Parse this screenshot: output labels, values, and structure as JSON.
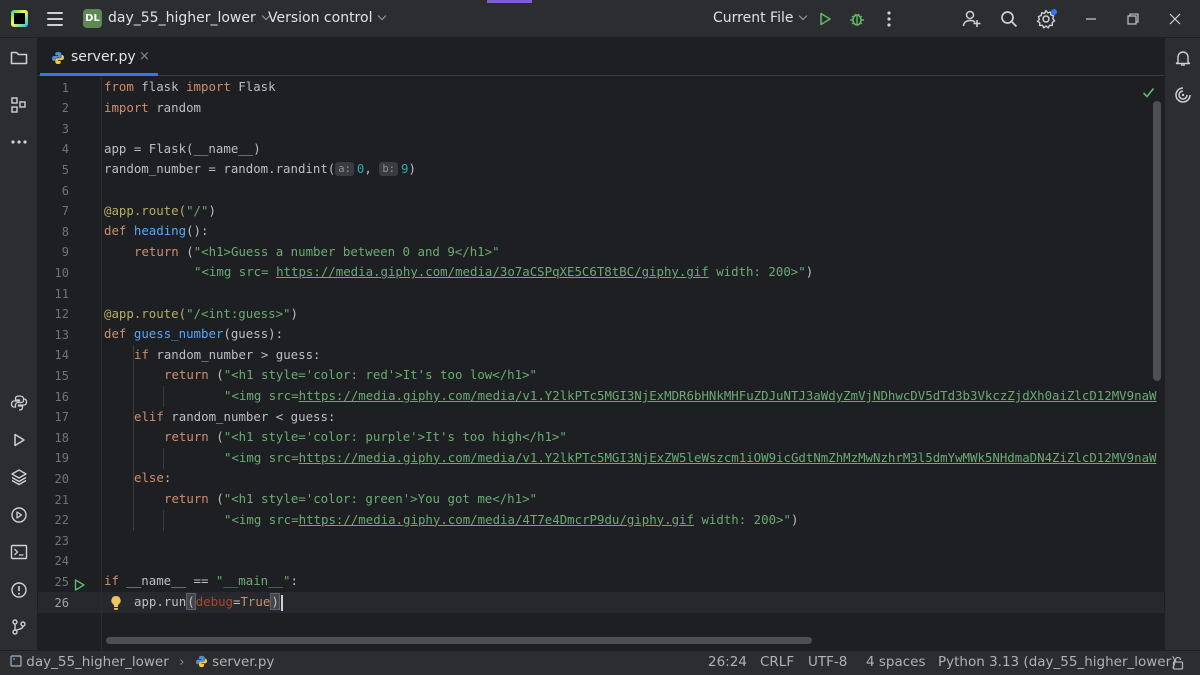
{
  "titlebar": {
    "project_initials": "DL",
    "project_name": "day_55_higher_lower",
    "vcs_label": "Version control",
    "run_config": "Current File"
  },
  "tabs": [
    {
      "label": "server.py",
      "close": "×"
    }
  ],
  "editor": {
    "line_numbers": [
      "1",
      "2",
      "3",
      "4",
      "5",
      "6",
      "7",
      "8",
      "9",
      "10",
      "11",
      "12",
      "13",
      "14",
      "15",
      "16",
      "17",
      "18",
      "19",
      "20",
      "21",
      "22",
      "23",
      "24",
      "25",
      "26"
    ],
    "inlay_hints": {
      "a": "a:",
      "b": "b:"
    },
    "lines": {
      "l1": [
        "from",
        " flask ",
        "import",
        " Flask"
      ],
      "l2": [
        "import",
        " random"
      ],
      "l4": "app = Flask(__name__)",
      "l5": [
        "random_number = random.randint(",
        "0",
        ", ",
        "9",
        ")"
      ],
      "l7": [
        "@app.route(",
        "\"/\"",
        ")"
      ],
      "l8": [
        "def",
        " ",
        "heading",
        "():"
      ],
      "l9": [
        "return",
        " (",
        "\"<h1>Guess a number between 0 and 9</h1>\""
      ],
      "l10": [
        "\"<img src= ",
        "https://media.giphy.com/media/3o7aCSPqXE5C6T8tBC/giphy.gif",
        " width: 200>\"",
        ")"
      ],
      "l12": [
        "@app.route(",
        "\"/<int:guess>\"",
        ")"
      ],
      "l13": [
        "def",
        " ",
        "guess_number",
        "(guess):"
      ],
      "l14": [
        "if",
        " random_number > guess:"
      ],
      "l15": [
        "return",
        " (",
        "\"<h1 style='color: red'>It's too low</h1>\""
      ],
      "l16": [
        "\"<img src=",
        "https://media.giphy.com/media/v1.Y2lkPTc5MGI3NjExMDR6bHNkMHFuZDJuNTJ3aWdyZmVjNDhwcDV5dTd3b3VkczZjdXh0aiZlcD12MV9naW"
      ],
      "l17": [
        "elif",
        " random_number < guess:"
      ],
      "l18": [
        "return",
        " (",
        "\"<h1 style='color: purple'>It's too high</h1>\""
      ],
      "l19": [
        "\"<img src=",
        "https://media.giphy.com/media/v1.Y2lkPTc5MGI3NjExZW5leWszcm1iOW9icGdtNmZhMzMwNzhrM3l5dmYwMWk5NHdmaDN4ZiZlcD12MV9naW"
      ],
      "l20": [
        "else",
        ":"
      ],
      "l21": [
        "return",
        " (",
        "\"<h1 style='color: green'>You got me</h1>\""
      ],
      "l22": [
        "\"<img src=",
        "https://media.giphy.com/media/4T7e4DmcrP9du/giphy.gif",
        " width: 200>\"",
        ")"
      ],
      "l25": [
        "if",
        " __name__ == ",
        "\"__main__\"",
        ":"
      ],
      "l26": [
        "app.run",
        "(",
        "debug",
        "=",
        "True",
        ")"
      ]
    }
  },
  "statusbar": {
    "breadcrumb_project": "day_55_higher_lower",
    "breadcrumb_file": "server.py",
    "caret_position": "26:24",
    "line_separator": "CRLF",
    "encoding": "UTF-8",
    "indent": "4 spaces",
    "interpreter": "Python 3.13 (day_55_higher_lower)"
  },
  "colors": {
    "accent": "#3574f0",
    "keyword": "#cf8e6d",
    "string": "#6aab73",
    "function": "#56a8f5",
    "decorator": "#b3ae60",
    "number": "#2aacb8"
  },
  "icons": [
    "app-logo-icon",
    "main-menu-icon",
    "run-icon",
    "debug-icon",
    "more-icon",
    "add-user-icon",
    "search-icon",
    "settings-icon",
    "minimize-icon",
    "restore-icon",
    "close-icon",
    "project-folder-icon",
    "structure-icon",
    "python-console-icon",
    "run-tool-icon",
    "layers-icon",
    "services-icon",
    "terminal-icon",
    "problems-icon",
    "git-icon",
    "notifications-icon",
    "ai-assistant-icon",
    "python-file-icon",
    "checkmark-icon",
    "lightbulb-icon",
    "run-gutter-icon"
  ]
}
